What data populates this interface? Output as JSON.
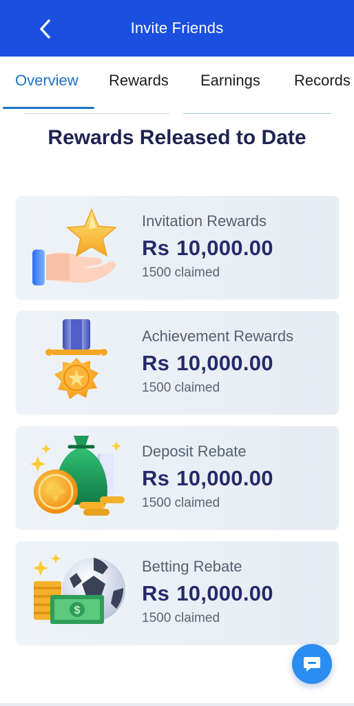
{
  "header": {
    "title": "Invite Friends",
    "back_icon": "chevron-left-icon"
  },
  "tabs": [
    {
      "label": "Overview",
      "active": true
    },
    {
      "label": "Rewards",
      "active": false
    },
    {
      "label": "Earnings",
      "active": false
    },
    {
      "label": "Records",
      "active": false
    }
  ],
  "section_title": "Rewards Released to Date",
  "cards": [
    {
      "label": "Invitation Rewards",
      "currency": "Rs",
      "amount": "10,000.00",
      "claimed": "1500 claimed",
      "icon": "hand-star-icon"
    },
    {
      "label": "Achievement Rewards",
      "currency": "Rs",
      "amount": "10,000.00",
      "claimed": "1500 claimed",
      "icon": "medal-icon"
    },
    {
      "label": "Deposit Rebate",
      "currency": "Rs",
      "amount": "10,000.00",
      "claimed": "1500 claimed",
      "icon": "money-bag-coins-icon"
    },
    {
      "label": "Betting Rebate",
      "currency": "Rs",
      "amount": "10,000.00",
      "claimed": "1500 claimed",
      "icon": "soccer-ball-cash-icon"
    }
  ],
  "chat": {
    "icon": "chat-bubble-icon"
  },
  "colors": {
    "header": "#1a4fe0",
    "active_tab": "#1d74c6",
    "title": "#1f2350",
    "amount": "#262a6a"
  }
}
